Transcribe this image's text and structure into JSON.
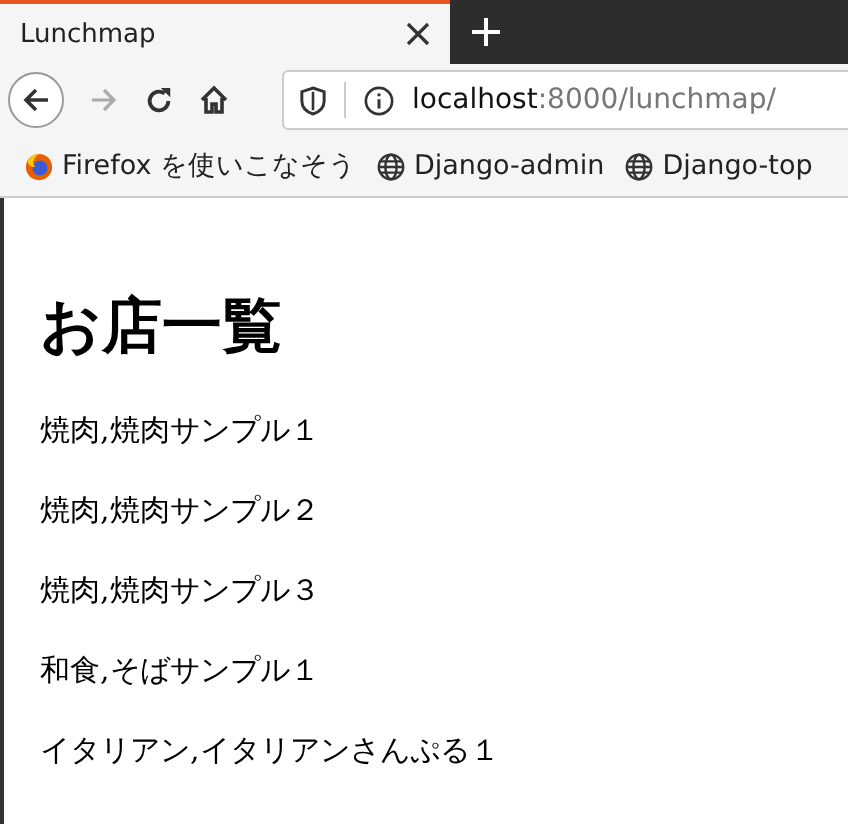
{
  "tab": {
    "title": "Lunchmap",
    "selected": true
  },
  "address": {
    "host": "localhost",
    "path": ":8000/lunchmap/"
  },
  "bookmarks": [
    {
      "kind": "firefox",
      "label": "Firefox を使いこなそう"
    },
    {
      "kind": "globe",
      "label": "Django-admin"
    },
    {
      "kind": "globe",
      "label": "Django-top"
    }
  ],
  "page": {
    "heading": "お店一覧",
    "items": [
      "焼肉,焼肉サンプル１",
      "焼肉,焼肉サンプル２",
      "焼肉,焼肉サンプル３",
      "和食,そばサンプル１",
      "イタリアン,イタリアンさんぷる１"
    ]
  }
}
